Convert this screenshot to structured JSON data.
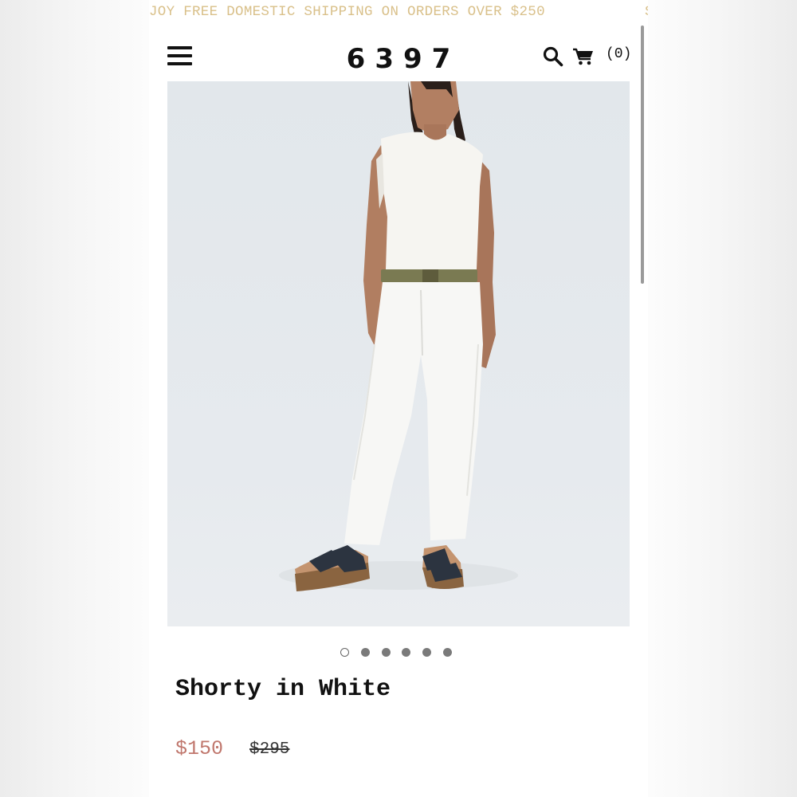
{
  "promo": {
    "text": "JOY FREE DOMESTIC SHIPPING ON ORDERS OVER $250",
    "next_fragment": "S"
  },
  "header": {
    "logo": "6397",
    "menu_icon": "hamburger-menu-icon",
    "search_icon": "search-icon",
    "cart_icon": "shopping-cart-icon",
    "cart_count": "(0)"
  },
  "gallery": {
    "image_alt": "Model wearing white sleeveless top, olive belt, white jeans and black sandals",
    "slide_count": 6,
    "active_slide": 1
  },
  "product": {
    "title": "Shorty in White",
    "sale_price": "$150",
    "original_price": "$295"
  },
  "colors": {
    "promo_text": "#d9c08a",
    "sale_price": "#c0776d",
    "text": "#111111"
  }
}
